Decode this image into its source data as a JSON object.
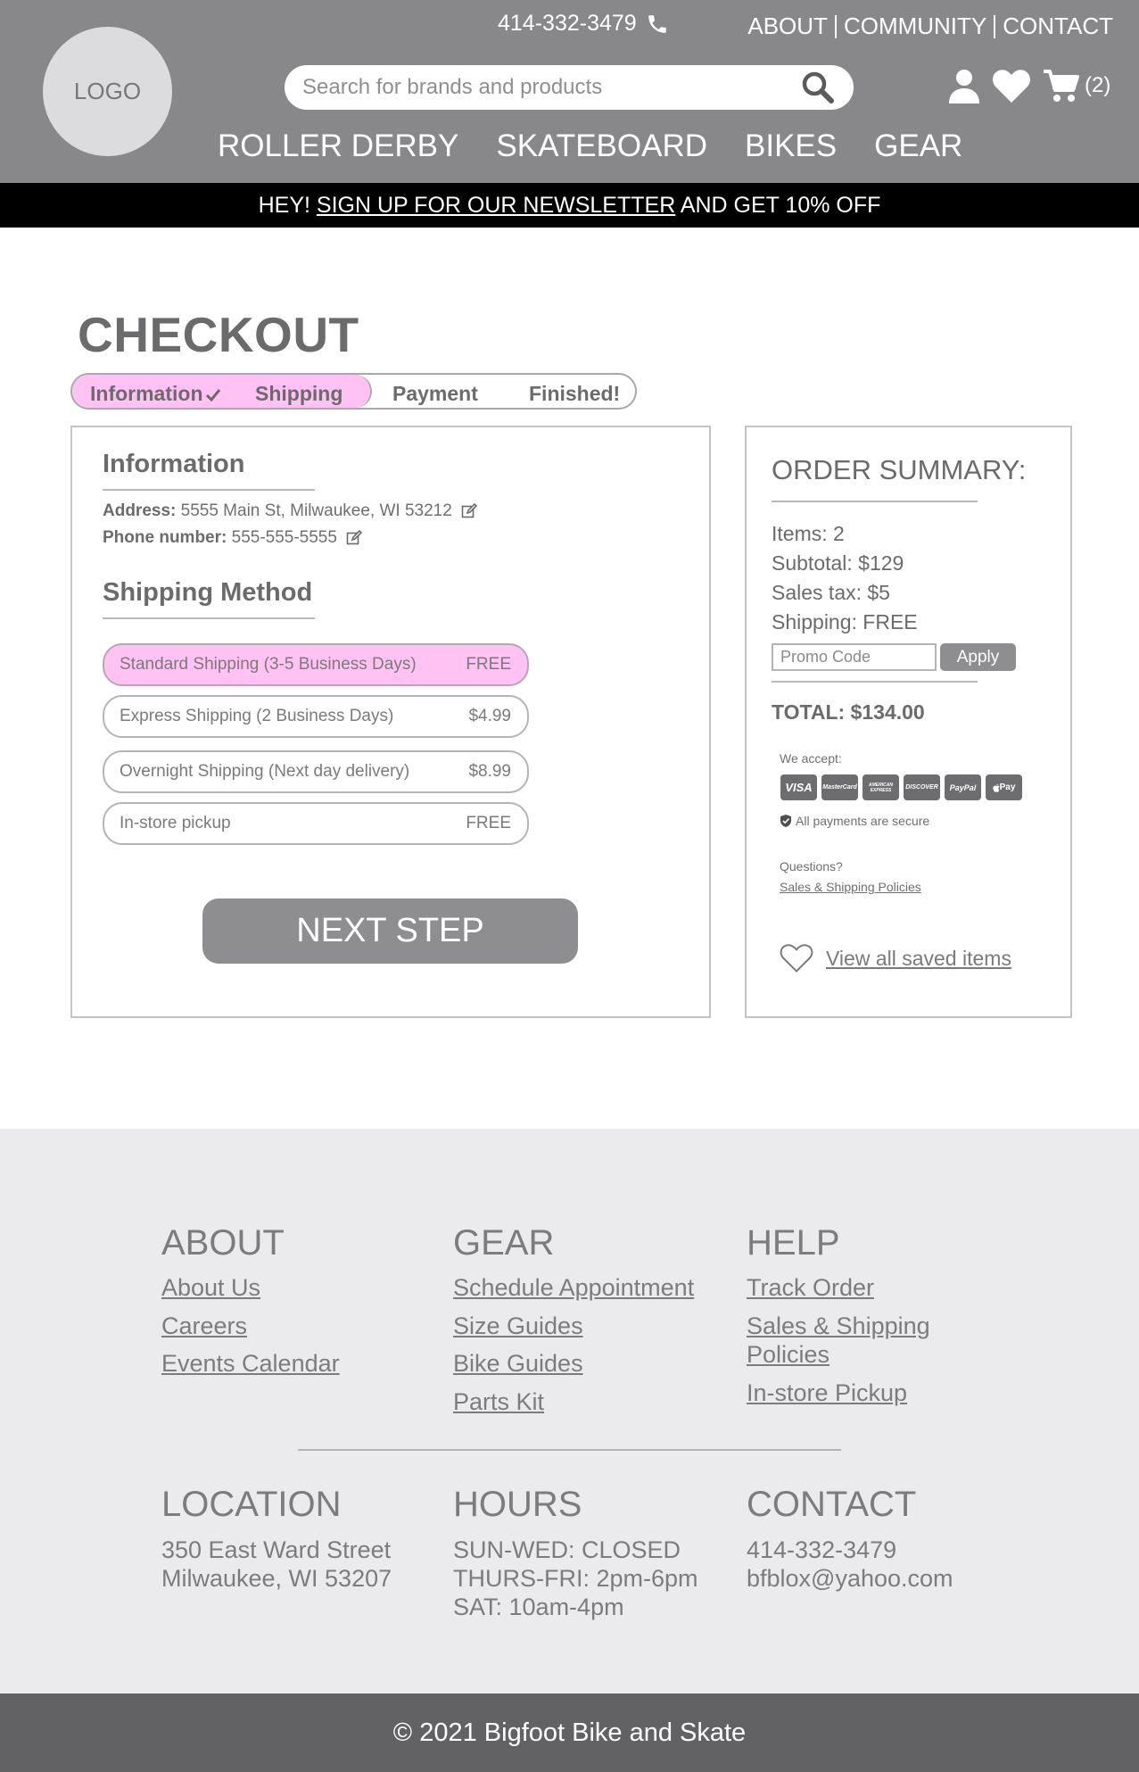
{
  "header": {
    "logo": "LOGO",
    "phone": "414-332-3479",
    "top_links": [
      "ABOUT",
      "COMMUNITY",
      "CONTACT"
    ],
    "search_placeholder": "Search for brands and products",
    "cart_count": "(2)",
    "main_nav": [
      "ROLLER DERBY",
      "SKATEBOARD",
      "BIKES",
      "GEAR"
    ],
    "promo": {
      "prefix": "HEY! ",
      "link": "SIGN UP FOR OUR NEWSLETTER",
      "suffix": " AND GET 10% OFF"
    }
  },
  "checkout": {
    "title": "CHECKOUT",
    "steps": [
      "Information",
      "Shipping",
      "Payment",
      "Finished!"
    ],
    "information": {
      "title": "Information",
      "address_label": "Address:",
      "address_value": " 5555 Main St, Milwaukee, WI 53212",
      "phone_label": "Phone number:",
      "phone_value": " 555-555-5555"
    },
    "shipping": {
      "title": "Shipping Method",
      "options": [
        {
          "label": "Standard Shipping (3-5 Business Days)",
          "price": "FREE"
        },
        {
          "label": "Express Shipping (2 Business Days)",
          "price": "$4.99"
        },
        {
          "label": "Overnight Shipping (Next day delivery)",
          "price": "$8.99"
        },
        {
          "label": "In-store pickup",
          "price": "FREE"
        }
      ]
    },
    "next_button": "NEXT STEP"
  },
  "summary": {
    "title": "ORDER SUMMARY:",
    "items": "Items: 2",
    "subtotal": "Subtotal: $129",
    "tax": "Sales tax: $5",
    "shipping": "Shipping: FREE",
    "promo_placeholder": "Promo Code",
    "apply": "Apply",
    "total": "TOTAL: $134.00",
    "accept_label": "We accept:",
    "cards": [
      "VISA",
      "MasterCard",
      "AMERICAN EXPRESS",
      "DISCOVER",
      "PayPal",
      "Pay"
    ],
    "secure": "All payments are secure",
    "questions": "Questions?",
    "policies_link": "Sales & Shipping Policies",
    "saved_link": "View all saved items"
  },
  "footer": {
    "about": {
      "title": "ABOUT",
      "links": [
        "About Us",
        "Careers",
        "Events Calendar"
      ]
    },
    "gear": {
      "title": "GEAR",
      "links": [
        "Schedule Appointment",
        "Size Guides",
        "Bike Guides",
        "Parts Kit"
      ]
    },
    "help": {
      "title": "HELP",
      "links": [
        "Track Order",
        "Sales & Shipping",
        "Policies",
        "In-store Pickup"
      ]
    },
    "location": {
      "title": "LOCATION",
      "lines": [
        "350 East Ward Street",
        "Milwaukee, WI 53207"
      ]
    },
    "hours": {
      "title": "HOURS",
      "lines": [
        "SUN-WED: CLOSED",
        "THURS-FRI: 2pm-6pm",
        "SAT: 10am-4pm"
      ]
    },
    "contact": {
      "title": "CONTACT",
      "lines": [
        "414-332-3479",
        "bfblox@yahoo.com"
      ]
    },
    "copyright": "© 2021 Bigfoot Bike and Skate"
  },
  "colors": {
    "header_bg": "#88888b",
    "accent_pink": "#ffc2f3",
    "banner_bg": "#000000",
    "footer_bg": "#ebebed",
    "copyright_bg": "#626265"
  },
  "icons": [
    "phone-icon",
    "search-icon",
    "user-icon",
    "heart-icon",
    "cart-icon",
    "check-icon",
    "edit-icon",
    "shield-icon",
    "heart-outline-icon"
  ]
}
